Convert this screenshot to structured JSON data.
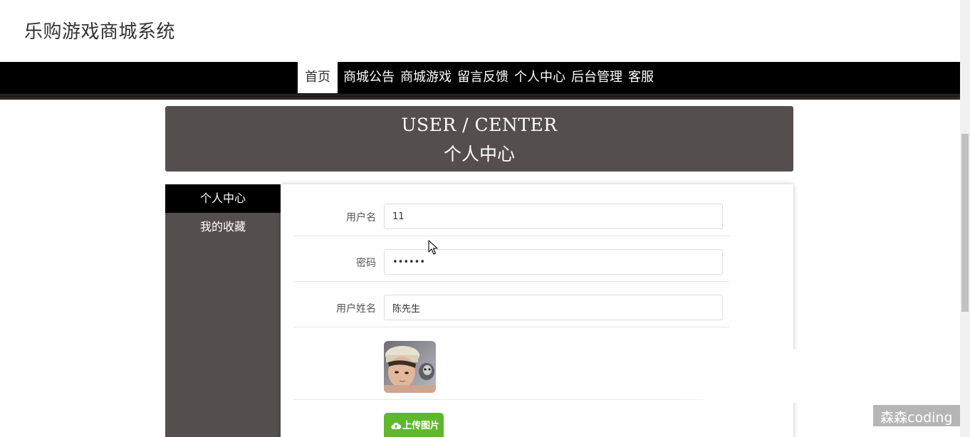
{
  "site": {
    "title": "乐购游戏商城系统"
  },
  "nav": {
    "items": [
      {
        "label": "首页",
        "active": true
      },
      {
        "label": "商城公告"
      },
      {
        "label": "商城游戏"
      },
      {
        "label": "留言反馈"
      },
      {
        "label": "个人中心"
      },
      {
        "label": "后台管理"
      },
      {
        "label": "客服"
      }
    ]
  },
  "banner": {
    "title_en": "USER / CENTER",
    "title_cn": "个人中心"
  },
  "sidebar": {
    "items": [
      {
        "label": "个人中心",
        "active": true
      },
      {
        "label": "我的收藏"
      }
    ]
  },
  "form": {
    "username_label": "用户名",
    "username_value": "11",
    "password_label": "密码",
    "password_value": "••••••",
    "name_label": "用户姓名",
    "name_value": "陈先生",
    "upload_label": "上传图片"
  },
  "icons": {
    "upload": "cloud-upload-icon"
  },
  "colors": {
    "accent_green": "#5fb82b",
    "banner_bg": "#554e4e",
    "nav_bg": "#000000"
  },
  "watermark": "森森coding"
}
